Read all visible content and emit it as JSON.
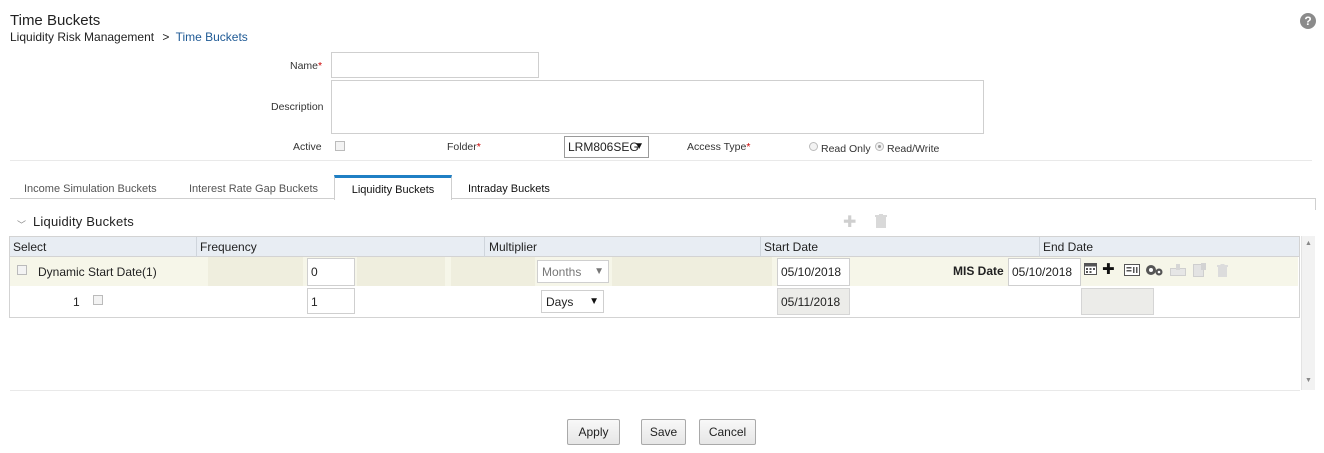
{
  "header": {
    "title": "Time Buckets",
    "breadcrumb_root": "Liquidity Risk Management",
    "breadcrumb_sep": ">",
    "breadcrumb_current": "Time Buckets",
    "help_glyph": "?"
  },
  "form": {
    "name_label": "Name",
    "name_value": "",
    "description_label": "Description",
    "description_value": "",
    "active_label": "Active",
    "folder_label": "Folder",
    "folder_value": "LRM806SEG",
    "access_type_label": "Access Type",
    "access_options": [
      "Read Only",
      "Read/Write"
    ],
    "access_selected": "Read/Write",
    "required_mark": "*"
  },
  "tabs": [
    {
      "label": "Income Simulation Buckets"
    },
    {
      "label": "Interest Rate Gap Buckets"
    },
    {
      "label": "Liquidity Buckets",
      "active": true
    },
    {
      "label": "Intraday Buckets"
    }
  ],
  "section": {
    "title": "Liquidity Buckets",
    "add_icon": "plus-icon",
    "delete_icon": "trash-icon"
  },
  "grid": {
    "columns": [
      "Select",
      "Frequency",
      "Multiplier",
      "Start Date",
      "End Date"
    ],
    "rows": [
      {
        "label": "Dynamic Start Date(1)",
        "frequency": "0",
        "multiplier": "Months",
        "start_date": "05/10/2018",
        "end_date_label": "MIS Date",
        "end_date": "05/10/2018"
      },
      {
        "label": "1",
        "frequency": "1",
        "multiplier": "Days",
        "start_date": "05/11/2018",
        "end_date": ""
      }
    ]
  },
  "buttons": {
    "apply": "Apply",
    "save": "Save",
    "cancel": "Cancel"
  }
}
